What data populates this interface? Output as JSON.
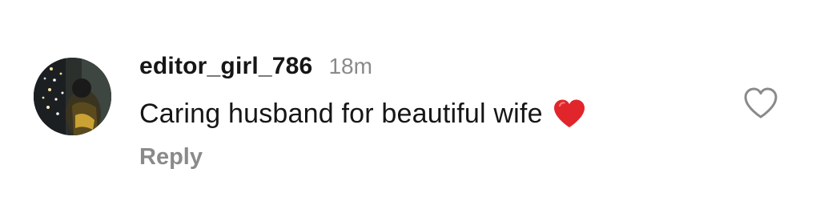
{
  "comment": {
    "username": "editor_girl_786",
    "timestamp": "18m",
    "text": "Caring husband for beautiful wife",
    "emoji": "red-heart-emoji",
    "reply_label": "Reply",
    "like_icon": "heart-outline-icon",
    "colors": {
      "username": "#161616",
      "text": "#161616",
      "muted": "#8a8a8a",
      "emoji_heart": "#e0262b",
      "background": "#ffffff"
    }
  }
}
